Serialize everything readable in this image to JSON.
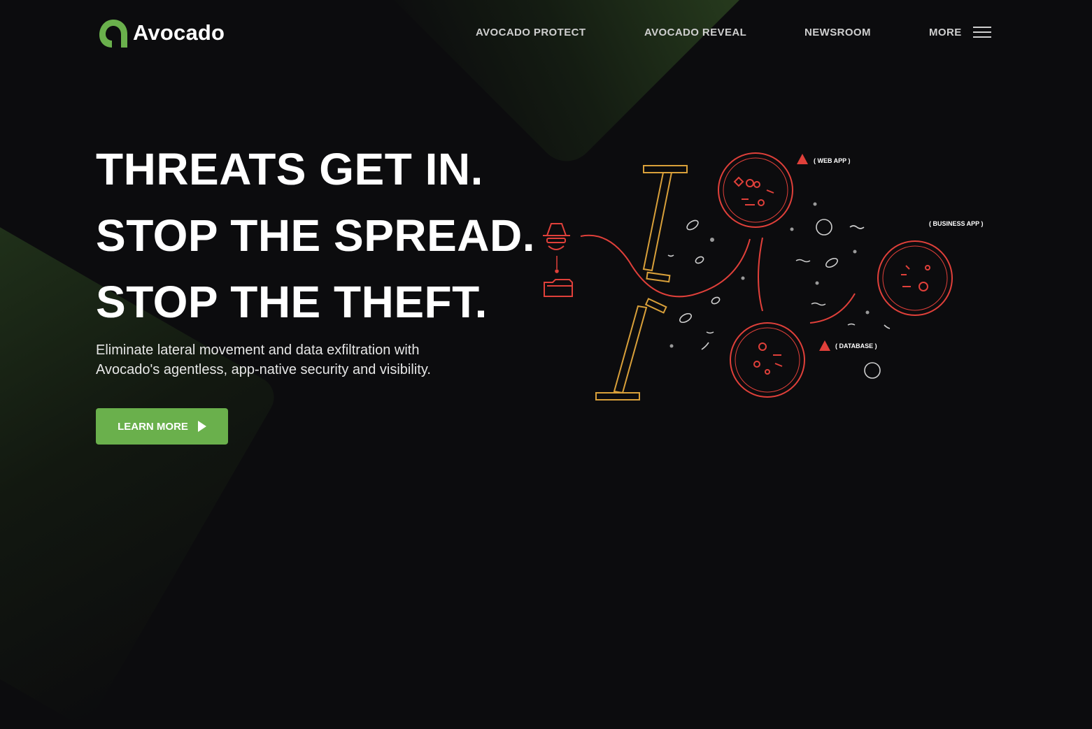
{
  "brand": {
    "name": "Avocado",
    "accent": "#6ab04c"
  },
  "nav": {
    "links": [
      {
        "label": "AVOCADO PROTECT"
      },
      {
        "label": "AVOCADO REVEAL"
      },
      {
        "label": "NEWSROOM"
      },
      {
        "label": "MORE"
      }
    ],
    "menu_icon": "hamburger-icon"
  },
  "hero": {
    "headline": [
      "THREATS GET IN.",
      "STOP THE SPREAD.",
      "STOP THE THEFT."
    ],
    "subtitle_lines": [
      "Eliminate lateral movement and data exfiltration with",
      "Avocado's agentless, app-native security and visibility."
    ],
    "cta_label": "LEARN MORE"
  },
  "illustration": {
    "labels": {
      "web_app": "( WEB APP )",
      "business_app": "( BUSINESS APP )",
      "database": "( DATABASE )"
    },
    "colors": {
      "threat": "#e0403a",
      "barrier": "#d9a03a",
      "dots": "#9a9a9a"
    }
  }
}
